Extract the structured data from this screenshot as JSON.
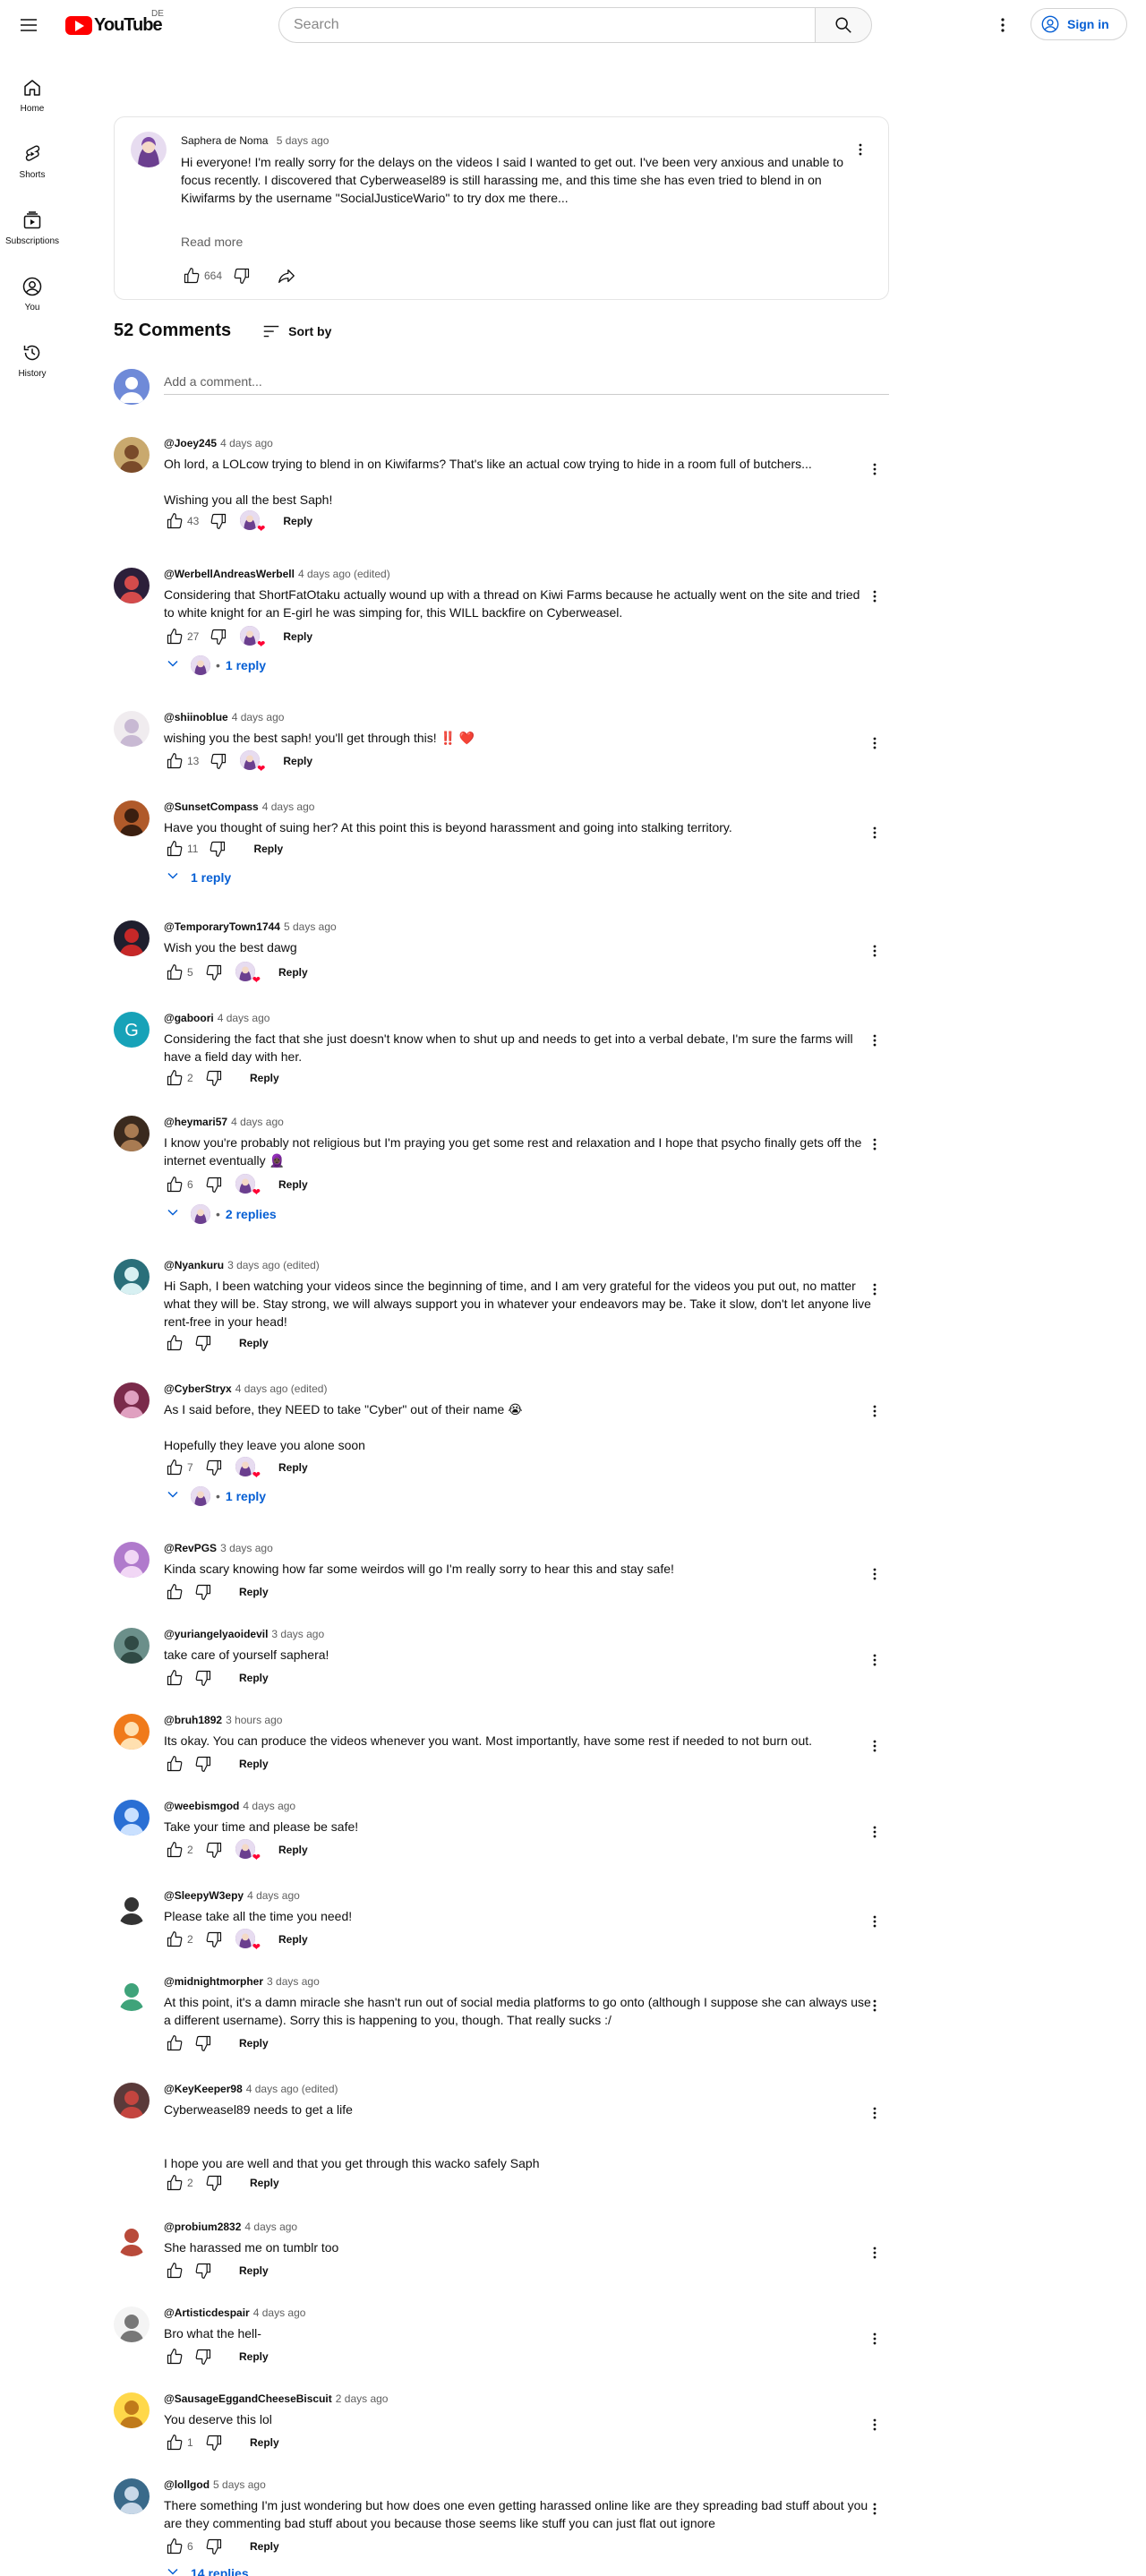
{
  "header": {
    "logo_text": "YouTube",
    "country_code": "DE",
    "search_placeholder": "Search",
    "signin_label": "Sign in"
  },
  "sidebar": {
    "items": [
      {
        "label": "Home",
        "icon": "home-icon"
      },
      {
        "label": "Shorts",
        "icon": "shorts-icon"
      },
      {
        "label": "Subscriptions",
        "icon": "subscriptions-icon"
      },
      {
        "label": "You",
        "icon": "you-icon"
      },
      {
        "label": "History",
        "icon": "history-icon"
      }
    ]
  },
  "post": {
    "author": "Saphera de Noma",
    "time": "5 days ago",
    "text": "Hi everyone! I'm really sorry for the delays on the videos I said I wanted to get out. I've been very anxious and unable to focus recently. I discovered that Cyberweasel89 is still harassing me, and this time she has even tried to blend in on Kiwifarms by the username \"SocialJusticeWario\" to try dox me there...",
    "read_more": "Read more",
    "likes": "664"
  },
  "comments_header": {
    "count": "52 Comments",
    "sort_label": "Sort by",
    "add_placeholder": "Add a comment..."
  },
  "labels": {
    "reply": "Reply"
  },
  "comments": [
    {
      "author": "@Joey245",
      "time": "4 days ago",
      "text": "Oh lord, a LOLcow trying to blend in on Kiwifarms? That's like an actual cow trying to hide in a room full of butchers...\n\nWishing you all the best Saph!",
      "likes": "43",
      "hearted": true,
      "replies": ""
    },
    {
      "author": "@WerbellAndreasWerbell",
      "time": "4 days ago (edited)",
      "text": "Considering that ShortFatOtaku actually wound up with a thread on Kiwi Farms because he actually went on the site and tried to white knight for an E-girl he was simping for, this WILL backfire on Cyberweasel.",
      "likes": "27",
      "hearted": true,
      "replies": "1 reply"
    },
    {
      "author": "@shiinoblue",
      "time": "4 days ago",
      "text": "wishing you the best saph! you'll get through this! ‼️ ❤️",
      "likes": "13",
      "hearted": true,
      "replies": ""
    },
    {
      "author": "@SunsetCompass",
      "time": "4 days ago",
      "text": "Have you thought of suing her? At this point this is beyond harassment and going into stalking territory.",
      "likes": "11",
      "hearted": false,
      "replies": "1 reply"
    },
    {
      "author": "@TemporaryTown1744",
      "time": "5 days ago",
      "text": "Wish you the best dawg",
      "likes": "5",
      "hearted": true,
      "replies": ""
    },
    {
      "author": "@gaboori",
      "time": "4 days ago",
      "text": "Considering the fact that she just doesn't know when to shut up and needs to get into a verbal debate, I'm sure the farms will have a field day with her.",
      "likes": "2",
      "hearted": false,
      "replies": ""
    },
    {
      "author": "@heymari57",
      "time": "4 days ago",
      "text": "I know you're probably not religious but I'm praying you get some rest and relaxation and I hope that psycho finally gets off the internet eventually 🧕🏿",
      "likes": "6",
      "hearted": true,
      "replies": "2 replies"
    },
    {
      "author": "@Nyankuru",
      "time": "3 days ago (edited)",
      "text": "Hi Saph, I been watching your videos since the beginning of time, and I am very grateful for the videos you put out, no matter what they will be. Stay strong, we will always support you in whatever your endeavors may be. Take it slow, don't let anyone live rent-free in your head!",
      "likes": "",
      "hearted": false,
      "replies": ""
    },
    {
      "author": "@CyberStryx",
      "time": "4 days ago (edited)",
      "text": "As I said before, they NEED to take \"Cyber\" out of their name 😭\n\nHopefully they leave you alone soon",
      "likes": "7",
      "hearted": true,
      "replies": "1 reply"
    },
    {
      "author": "@RevPGS",
      "time": "3 days ago",
      "text": "Kinda scary knowing how far some weirdos will go I'm really sorry to hear this and stay safe!",
      "likes": "",
      "hearted": false,
      "replies": ""
    },
    {
      "author": "@yuriangelyaoidevil",
      "time": "3 days ago",
      "text": "take care of yourself saphera!",
      "likes": "",
      "hearted": false,
      "replies": ""
    },
    {
      "author": "@bruh1892",
      "time": "3 hours ago",
      "text": "Its okay. You can produce the videos whenever you want. Most importantly, have some rest if needed to not burn out.",
      "likes": "",
      "hearted": false,
      "replies": ""
    },
    {
      "author": "@weebismgod",
      "time": "4 days ago",
      "text": "Take your time and please be safe!",
      "likes": "2",
      "hearted": true,
      "replies": ""
    },
    {
      "author": "@SleepyW3epy",
      "time": "4 days ago",
      "text": "Please take all the time you need!",
      "likes": "2",
      "hearted": true,
      "replies": ""
    },
    {
      "author": "@midnightmorpher",
      "time": "3 days ago",
      "text": "At this point, it's a damn miracle she hasn't run out of social media platforms to go onto (although I suppose she can always use a different username). Sorry this is happening to you, though. That really sucks :/",
      "likes": "",
      "hearted": false,
      "replies": ""
    },
    {
      "author": "@KeyKeeper98",
      "time": "4 days ago (edited)",
      "text": "Cyberweasel89 needs to get a life\n\n\nI hope you are well and that you get through this wacko safely Saph",
      "likes": "2",
      "hearted": false,
      "replies": ""
    },
    {
      "author": "@probium2832",
      "time": "4 days ago",
      "text": "She harassed me on tumblr too",
      "likes": "",
      "hearted": false,
      "replies": ""
    },
    {
      "author": "@Artisticdespair",
      "time": "4 days ago",
      "text": "Bro what the hell-",
      "likes": "",
      "hearted": false,
      "replies": ""
    },
    {
      "author": "@SausageEggandCheeseBiscuit",
      "time": "2 days ago",
      "text": "You deserve this lol",
      "likes": "1",
      "hearted": false,
      "replies": ""
    },
    {
      "author": "@lollgod",
      "time": "5 days ago",
      "text": "There something I'm just wondering but how does one even getting harassed online like are they spreading bad stuff about you are they commenting bad stuff about you because those seems like stuff you can just flat out ignore",
      "likes": "6",
      "hearted": false,
      "replies": "14 replies"
    }
  ],
  "colors": {
    "brand_red": "#ff0000",
    "link_blue": "#065fd4",
    "heart_red": "#ff0033"
  }
}
